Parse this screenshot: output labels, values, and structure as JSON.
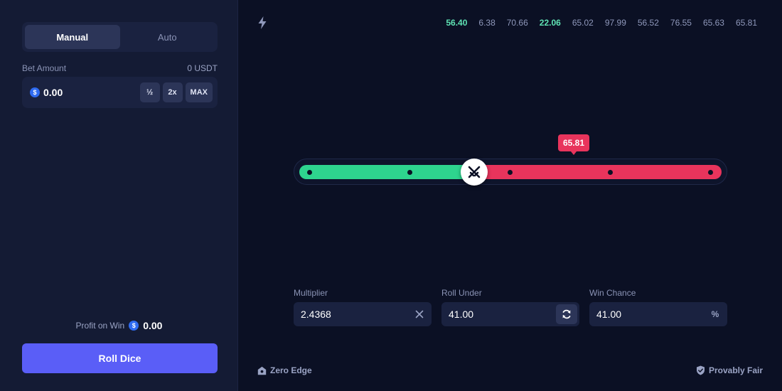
{
  "sidebar": {
    "tabs": [
      {
        "label": "Manual",
        "active": true
      },
      {
        "label": "Auto",
        "active": false
      }
    ],
    "bet": {
      "label": "Bet Amount",
      "balance": "0 USDT",
      "value": "0.00",
      "currency_symbol": "$",
      "buttons": {
        "half": "½",
        "double": "2x",
        "max": "MAX"
      }
    },
    "profit": {
      "label": "Profit on Win",
      "value": "0.00",
      "currency_symbol": "$"
    },
    "roll_button": "Roll Dice"
  },
  "history": [
    {
      "value": "56.40",
      "win": true
    },
    {
      "value": "6.38",
      "win": false
    },
    {
      "value": "70.66",
      "win": false
    },
    {
      "value": "22.06",
      "win": true
    },
    {
      "value": "65.02",
      "win": false
    },
    {
      "value": "97.99",
      "win": false
    },
    {
      "value": "56.52",
      "win": false
    },
    {
      "value": "76.55",
      "win": false
    },
    {
      "value": "65.63",
      "win": false
    },
    {
      "value": "65.81",
      "win": false
    }
  ],
  "slider": {
    "threshold": 41.0,
    "result": "65.81",
    "colors": {
      "win": "#2ed48e",
      "lose": "#e8345c"
    }
  },
  "fields": {
    "multiplier": {
      "label": "Multiplier",
      "value": "2.4368"
    },
    "roll_under": {
      "label": "Roll Under",
      "value": "41.00"
    },
    "win_chance": {
      "label": "Win Chance",
      "value": "41.00",
      "suffix": "%"
    }
  },
  "footer": {
    "left": "Zero Edge",
    "right": "Provably Fair"
  },
  "colors": {
    "accent": "#5a5ef7",
    "win_text": "#5fe3b4"
  }
}
